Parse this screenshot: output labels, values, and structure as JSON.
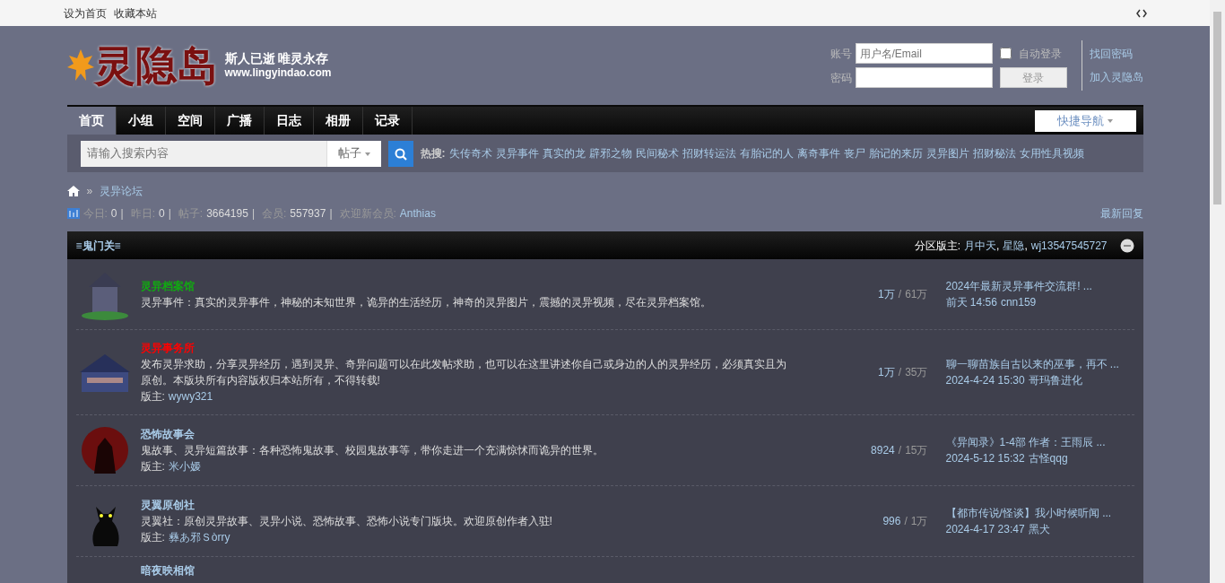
{
  "top_links": [
    "设为首页",
    "收藏本站"
  ],
  "logo": {
    "title": "灵隐岛",
    "slogan": "斯人已逝 唯灵永存",
    "url": "www.lingyindao.com"
  },
  "login": {
    "account_label": "账号",
    "account_placeholder": "用户名/Email",
    "auto_login": {
      "label": "自动登录",
      "checked": false
    },
    "password_label": "密码",
    "login_button": "登录",
    "links": [
      "找回密码",
      "加入灵隐岛"
    ]
  },
  "nav": {
    "tabs": [
      {
        "label": "首页",
        "selected": true
      },
      {
        "label": "小组",
        "selected": false
      },
      {
        "label": "空间",
        "selected": false
      },
      {
        "label": "广播",
        "selected": false
      },
      {
        "label": "日志",
        "selected": false
      },
      {
        "label": "相册",
        "selected": false
      },
      {
        "label": "记录",
        "selected": false
      }
    ],
    "quick_nav": "快捷导航"
  },
  "search": {
    "placeholder": "请输入搜索内容",
    "type": "帖子",
    "hot_label": "热搜:",
    "hot": [
      "失传奇术",
      "灵异事件",
      "真实的龙",
      "辟邪之物",
      "民间秘术",
      "招财转运法",
      "有胎记的人",
      "离奇事件",
      "丧尸",
      "胎记的来历",
      "灵异图片",
      "招财秘法",
      "女用性具视频"
    ]
  },
  "breadcrumb": {
    "separator": "»",
    "current": "灵异论坛"
  },
  "stats": [
    {
      "label": "今日:",
      "value": "0"
    },
    {
      "label": "昨日:",
      "value": "0"
    },
    {
      "label": "帖子:",
      "value": "3664195"
    },
    {
      "label": "会员:",
      "value": "557937"
    },
    {
      "label": "欢迎新会员:",
      "value": "Anthias"
    }
  ],
  "stats_separator": "|",
  "latest_link": "最新回复",
  "section": {
    "title": "≡鬼门关≡",
    "moderators_label": "分区版主:",
    "moderators": [
      "月中天",
      "星隐",
      "wj13547545727"
    ],
    "moderator_separator": ","
  },
  "count_separator": "/",
  "forums": [
    {
      "name": "灵异档案馆",
      "color": "#11aa11",
      "description": "灵异事件：真实的灵异事件，神秘的未知世界，诡异的生活经历，神奇的灵异图片，震撼的灵异视频，尽在灵异档案馆。",
      "threads": "1万",
      "posts": "61万",
      "last_title": "2024年最新灵异事件交流群!  ...",
      "last_time": "前天 14:56",
      "last_user": "cnn159"
    },
    {
      "name": "灵异事务所",
      "color": "#ff0000",
      "description": "发布灵异求助，分享灵异经历，遇到灵异、奇异问题可以在此发帖求助，也可以在这里讲述你自己或身边的人的灵异经历，必须真实且为原创。本版块所有内容版权归本站所有，不得转载!",
      "moderator_label": "版主:",
      "moderator": "wywy321",
      "threads": "1万",
      "posts": "35万",
      "last_title": "聊一聊苗族自古以来的巫事，再不 ...",
      "last_time": "2024-4-24 15:30",
      "last_user": "哥玛鲁进化"
    },
    {
      "name": "恐怖故事会",
      "color": "#a9cbe8",
      "description": "鬼故事、灵异短篇故事：各种恐怖鬼故事、校园鬼故事等，带你走进一个充满惊怵而诡异的世界。",
      "moderator_label": "版主:",
      "moderator": "米小嫒",
      "threads": "8924",
      "posts": "15万",
      "last_title": "《异闻录》1-4部 作者：王雨辰 ...",
      "last_time": "2024-5-12 15:32",
      "last_user": "古怪qqg"
    },
    {
      "name": "灵翼原创社",
      "color": "#a9cbe8",
      "description": "灵翼社：原创灵异故事、灵异小说、恐怖故事、恐怖小说专门版块。欢迎原创作者入驻!",
      "moderator_label": "版主:",
      "moderator": "彝あ邪Ｓòrry",
      "threads": "996",
      "posts": "1万",
      "last_title": "【都市传说/怪谈】我小时候听闻 ...",
      "last_time": "2024-4-17 23:47",
      "last_user": "黑犬"
    },
    {
      "name": "暗夜映相馆",
      "color": "#a9cbe8"
    }
  ]
}
